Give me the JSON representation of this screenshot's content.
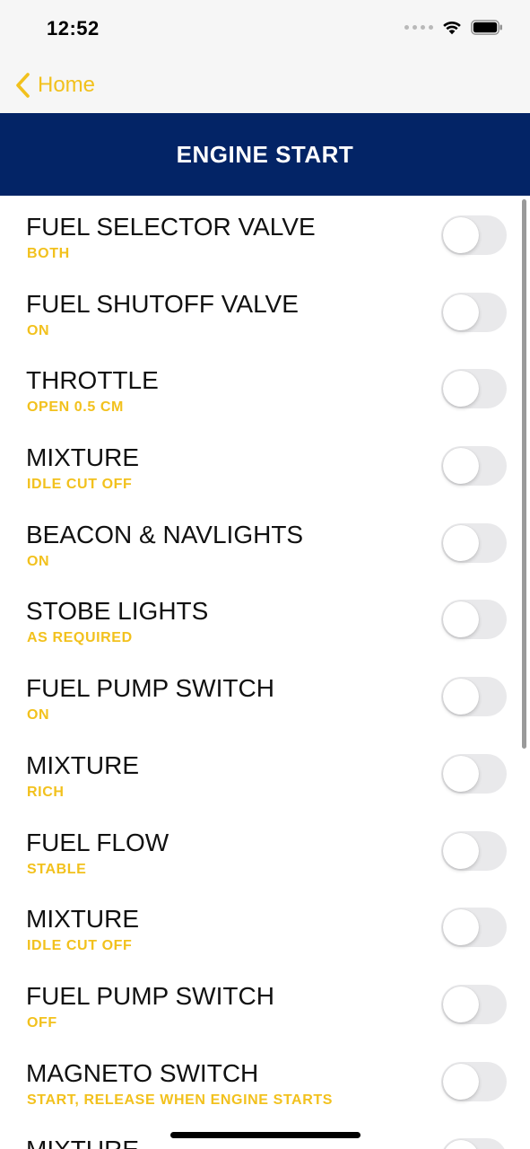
{
  "status_bar": {
    "time": "12:52",
    "icons": [
      "cellular-signal-icon",
      "wifi-icon",
      "battery-icon"
    ]
  },
  "nav": {
    "back_label": "Home",
    "back_icon": "chevron-left-icon"
  },
  "header": {
    "title": "ENGINE START"
  },
  "colors": {
    "accent": "#f2c11d",
    "header_bg": "#032466",
    "toggle_off": "#e9e9eb"
  },
  "checklist": [
    {
      "title": "FUEL SELECTOR VALVE",
      "value": "BOTH",
      "checked": false
    },
    {
      "title": "FUEL SHUTOFF VALVE",
      "value": "ON",
      "checked": false
    },
    {
      "title": "THROTTLE",
      "value": "OPEN 0.5 CM",
      "checked": false
    },
    {
      "title": "MIXTURE",
      "value": "IDLE CUT OFF",
      "checked": false
    },
    {
      "title": "BEACON & NAVLIGHTS",
      "value": "ON",
      "checked": false
    },
    {
      "title": "STOBE LIGHTS",
      "value": "AS REQUIRED",
      "checked": false
    },
    {
      "title": "FUEL PUMP SWITCH",
      "value": "ON",
      "checked": false
    },
    {
      "title": "MIXTURE",
      "value": "RICH",
      "checked": false
    },
    {
      "title": "FUEL FLOW",
      "value": "STABLE",
      "checked": false
    },
    {
      "title": "MIXTURE",
      "value": "IDLE CUT OFF",
      "checked": false
    },
    {
      "title": "FUEL PUMP SWITCH",
      "value": "OFF",
      "checked": false
    },
    {
      "title": "MAGNETO SWITCH",
      "value": "START, RELEASE WHEN ENGINE STARTS",
      "checked": false
    },
    {
      "title": "MIXTURE",
      "value": "",
      "checked": false
    }
  ]
}
